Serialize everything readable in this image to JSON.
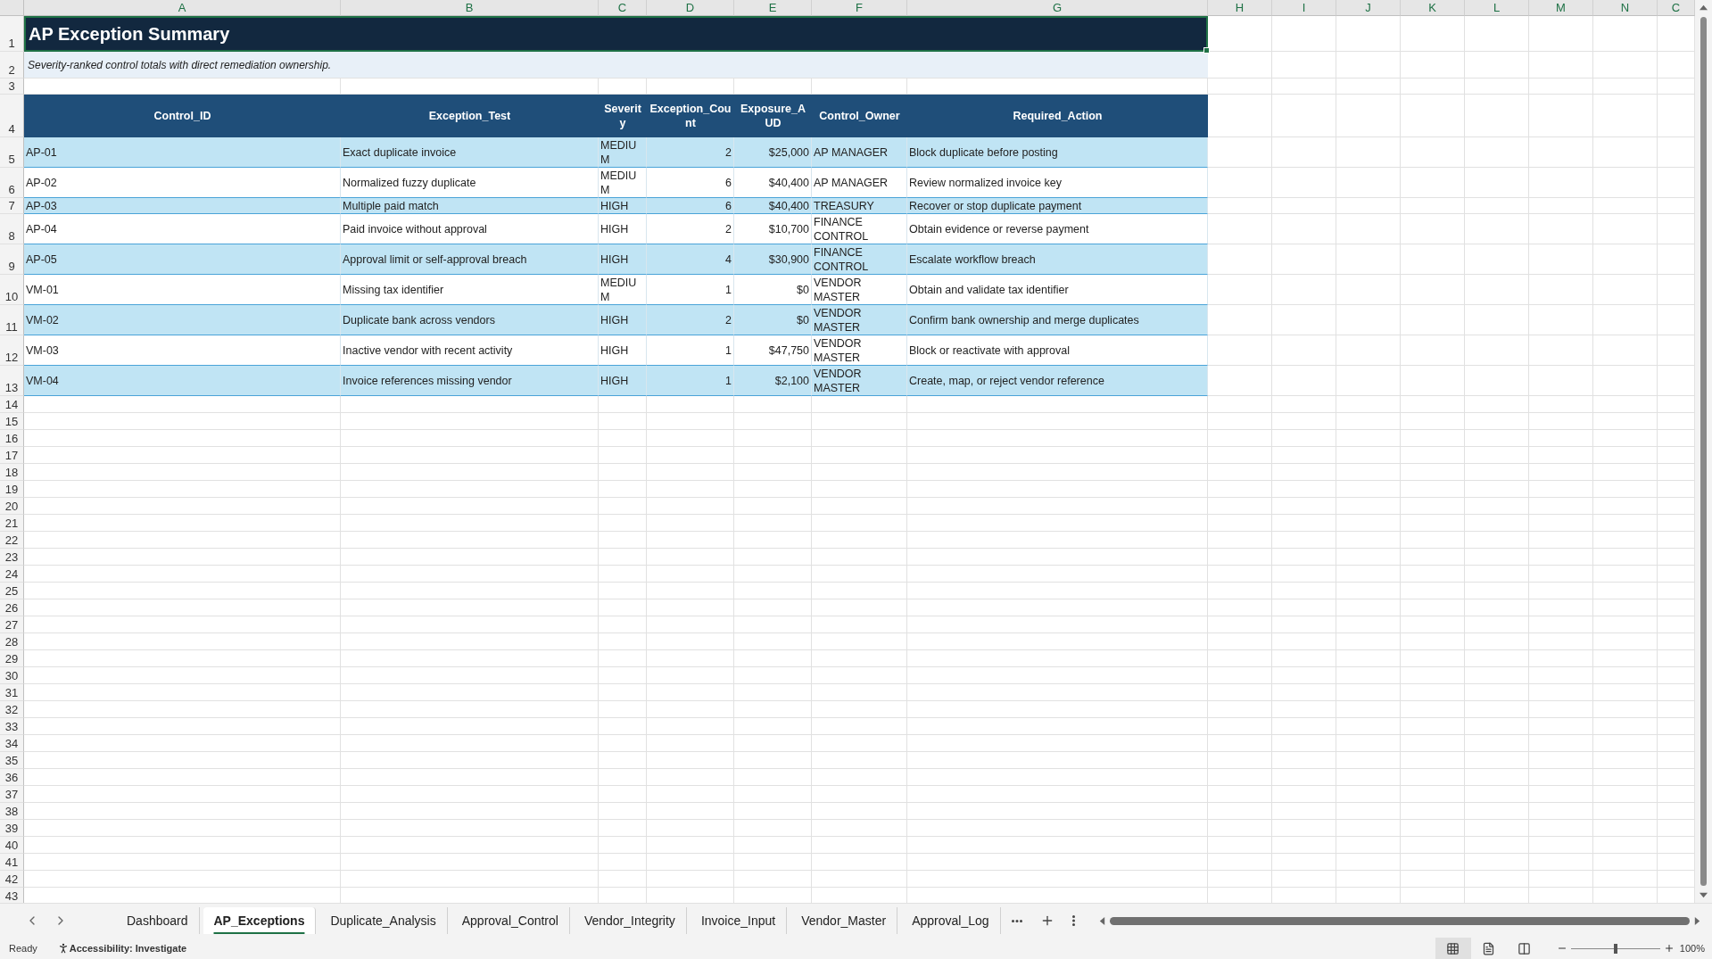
{
  "column_letters": [
    "A",
    "B",
    "C",
    "D",
    "E",
    "F",
    "G",
    "H",
    "I",
    "J",
    "K",
    "L",
    "M",
    "N",
    "C"
  ],
  "title": "AP Exception Summary",
  "subtitle": "Severity-ranked control totals with direct remediation ownership.",
  "table": {
    "columns": [
      {
        "label": "Control_ID",
        "kind": "text"
      },
      {
        "label": "Exception_Test",
        "kind": "text"
      },
      {
        "label": "Severity",
        "kind": "text"
      },
      {
        "label": "Exception_Count",
        "kind": "number"
      },
      {
        "label": "Exposure_AUD",
        "kind": "number"
      },
      {
        "label": "Control_Owner",
        "kind": "text"
      },
      {
        "label": "Required_Action",
        "kind": "text"
      }
    ],
    "rows": [
      {
        "cells": [
          "AP-01",
          "Exact duplicate invoice",
          "MEDIUM",
          "2",
          "$25,000",
          "AP MANAGER",
          "Block duplicate before posting"
        ]
      },
      {
        "cells": [
          "AP-02",
          "Normalized fuzzy duplicate",
          "MEDIUM",
          "6",
          "$40,400",
          "AP MANAGER",
          "Review normalized invoice key"
        ]
      },
      {
        "cells": [
          "AP-03",
          "Multiple paid match",
          "HIGH",
          "6",
          "$40,400",
          "TREASURY",
          "Recover or stop duplicate payment"
        ]
      },
      {
        "cells": [
          "AP-04",
          "Paid invoice without approval",
          "HIGH",
          "2",
          "$10,700",
          "FINANCE CONTROL",
          "Obtain evidence or reverse payment"
        ]
      },
      {
        "cells": [
          "AP-05",
          "Approval limit or self-approval breach",
          "HIGH",
          "4",
          "$30,900",
          "FINANCE CONTROL",
          "Escalate workflow breach"
        ]
      },
      {
        "cells": [
          "VM-01",
          "Missing tax identifier",
          "MEDIUM",
          "1",
          "$0",
          "VENDOR MASTER",
          "Obtain and validate tax identifier"
        ]
      },
      {
        "cells": [
          "VM-02",
          "Duplicate bank across vendors",
          "HIGH",
          "2",
          "$0",
          "VENDOR MASTER",
          "Confirm bank ownership and merge duplicates"
        ]
      },
      {
        "cells": [
          "VM-03",
          "Inactive vendor with recent activity",
          "HIGH",
          "1",
          "$47,750",
          "VENDOR MASTER",
          "Block or reactivate with approval"
        ]
      },
      {
        "cells": [
          "VM-04",
          "Invoice references missing vendor",
          "HIGH",
          "1",
          "$2,100",
          "VENDOR MASTER",
          "Create, map, or reject vendor reference"
        ]
      }
    ]
  },
  "row_numbers": [
    "1",
    "2",
    "3",
    "4",
    "5",
    "6",
    "7",
    "8",
    "9",
    "10",
    "11",
    "12",
    "13",
    "14",
    "15",
    "16",
    "17",
    "18",
    "19",
    "20",
    "21",
    "22",
    "23",
    "24",
    "25",
    "26",
    "27",
    "28",
    "29",
    "30",
    "31",
    "32",
    "33",
    "34",
    "35",
    "36",
    "37",
    "38",
    "39",
    "40",
    "41",
    "42",
    "43"
  ],
  "sheet_tabs": [
    {
      "label": "Dashboard",
      "selected": false
    },
    {
      "label": "AP_Exceptions",
      "selected": true
    },
    {
      "label": "Duplicate_Analysis",
      "selected": false
    },
    {
      "label": "Approval_Control",
      "selected": false
    },
    {
      "label": "Vendor_Integrity",
      "selected": false
    },
    {
      "label": "Invoice_Input",
      "selected": false
    },
    {
      "label": "Vendor_Master",
      "selected": false
    },
    {
      "label": "Approval_Log",
      "selected": false
    }
  ],
  "status_bar": {
    "status": "Ready",
    "accessibility": "Accessibility: Investigate",
    "zoom": "100%",
    "view_modes": [
      {
        "kind": "normal",
        "selected": true
      },
      {
        "kind": "page-layout",
        "selected": false
      },
      {
        "kind": "page-break",
        "selected": false
      }
    ],
    "zoom_slider": {
      "level": 0.5
    }
  }
}
